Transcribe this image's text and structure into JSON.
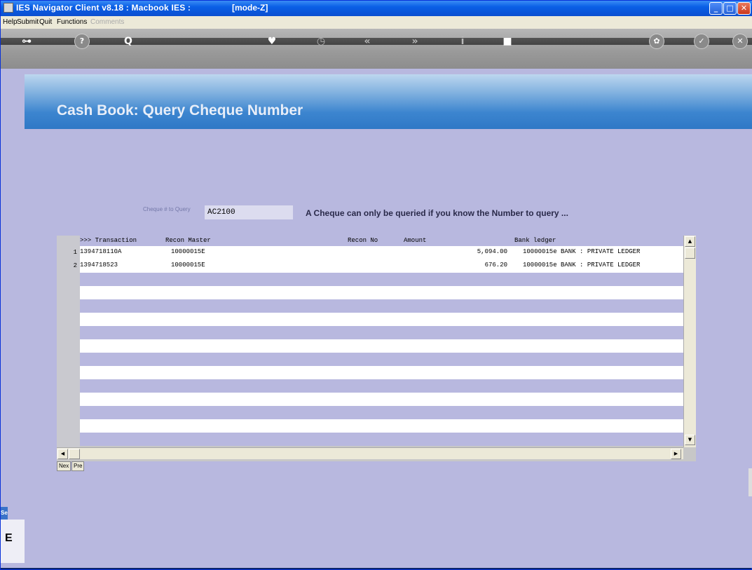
{
  "window": {
    "title": "IES Navigator Client v8.18 : Macbook IES :",
    "mode": "[mode-Z]",
    "controls": {
      "minimize": "_",
      "maximize": "□",
      "close": "✕"
    }
  },
  "menu": {
    "items": [
      "Help",
      "Submit",
      "Quit",
      "Functions"
    ],
    "disabled_item": "Comments"
  },
  "toolbar": {
    "icons": [
      "key-icon",
      "help-icon",
      "search-icon",
      "heart-icon",
      "clock-icon",
      "rewind-icon",
      "forward-icon",
      "info-icon",
      "stop-icon",
      "settings-icon",
      "check-icon",
      "close-icon"
    ],
    "glyphs": {
      "key": "⊶",
      "help": "?",
      "search": "Q",
      "heart": "♥",
      "clock": "◷",
      "rewind": "«",
      "forward": "»",
      "info": "i",
      "stop": "■",
      "settings": "✿",
      "check": "✓",
      "close": "✕"
    }
  },
  "page": {
    "heading": "Cash Book: Query Cheque Number"
  },
  "query": {
    "label": "Cheque # to Query",
    "value": "AC2100",
    "help": "A Cheque can only be queried if you know the Number to query ..."
  },
  "grid": {
    "columns": [
      ">>> Transaction",
      "Recon Master",
      "Recon No",
      "Amount",
      "Bank ledger"
    ],
    "rows": [
      {
        "num": "1",
        "transaction": "1394718110A",
        "recon_master": "10000015E",
        "recon_no": "",
        "amount": "5,094.00",
        "bank_ledger": "10000015e BANK : PRIVATE LEDGER"
      },
      {
        "num": "2",
        "transaction": "1394718523",
        "recon_master": "10000015E",
        "recon_no": "",
        "amount": "676.20",
        "bank_ledger": "10000015e BANK : PRIVATE LEDGER"
      }
    ],
    "scroll": {
      "up": "▲",
      "down": "▼",
      "left": "◀",
      "right": "▶"
    }
  },
  "pager": {
    "next": "Nex",
    "prev": "Pre"
  },
  "side_tab": {
    "label": "Sel",
    "box_text": "E"
  },
  "colors": {
    "titlebar": "#0a5fe6",
    "content_bg": "#b8b8df",
    "banner": "#3c85cf",
    "heading": "#e8eef8"
  }
}
